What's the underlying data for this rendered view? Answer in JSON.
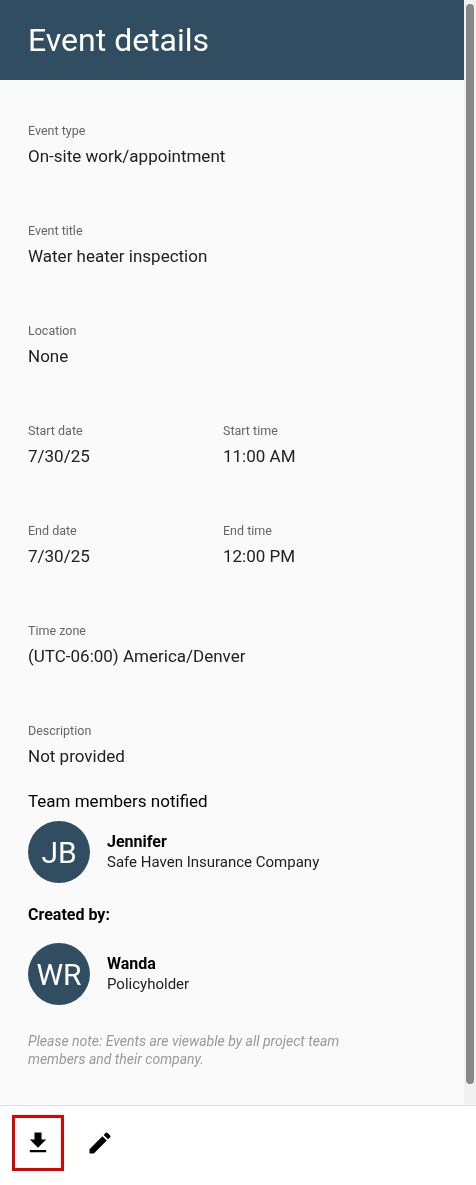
{
  "header": {
    "title": "Event details"
  },
  "fields": [
    {
      "label": "Event type",
      "value": "On-site work/appointment"
    },
    {
      "label": "Event title",
      "value": "Water heater inspection"
    },
    {
      "label": "Location",
      "value": "None"
    },
    {
      "label": "Start date",
      "value": "7/30/25",
      "pair": {
        "label": "Start time",
        "value": "11:00 AM"
      }
    },
    {
      "label": "End date",
      "value": "7/30/25",
      "pair": {
        "label": "End time",
        "value": "12:00 PM"
      }
    },
    {
      "label": "Time zone",
      "value": "(UTC-06:00) America/Denver"
    },
    {
      "label": "Description",
      "value": "Not provided"
    }
  ],
  "team": {
    "heading": "Team members notified",
    "members": [
      {
        "initials": "JB",
        "name": "Jennifer",
        "company": "Safe Haven Insurance Company"
      }
    ]
  },
  "created_by": {
    "heading": "Created by:",
    "initials": "WR",
    "name": "Wanda",
    "role": "Policyholder"
  },
  "note": "Please note: Events are viewable by all project team members and their company.",
  "actions": [
    {
      "kind": "download",
      "highlighted": true
    },
    {
      "kind": "edit",
      "highlighted": false
    }
  ]
}
